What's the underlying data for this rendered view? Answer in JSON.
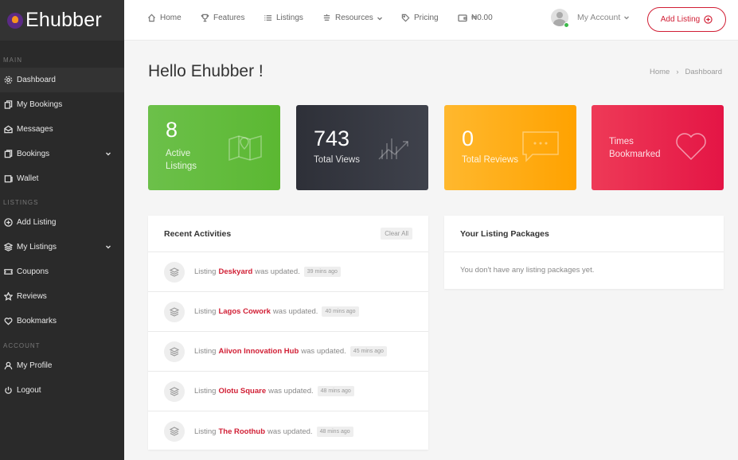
{
  "brand": {
    "name": "Ehubber"
  },
  "sidebar": {
    "sections": [
      {
        "label": "MAIN",
        "items": [
          {
            "label": "Dashboard",
            "icon": "gear-icon",
            "active": true
          },
          {
            "label": "My Bookings",
            "icon": "bookmark-copy-icon"
          },
          {
            "label": "Messages",
            "icon": "envelope-icon"
          },
          {
            "label": "Bookings",
            "icon": "calendar-icon",
            "expandable": true
          },
          {
            "label": "Wallet",
            "icon": "wallet-icon"
          }
        ]
      },
      {
        "label": "LISTINGS",
        "items": [
          {
            "label": "Add Listing",
            "icon": "plus-circle-icon"
          },
          {
            "label": "My Listings",
            "icon": "layers-icon",
            "expandable": true
          },
          {
            "label": "Coupons",
            "icon": "ticket-icon"
          },
          {
            "label": "Reviews",
            "icon": "star-icon"
          },
          {
            "label": "Bookmarks",
            "icon": "heart-icon"
          }
        ]
      },
      {
        "label": "ACCOUNT",
        "items": [
          {
            "label": "My Profile",
            "icon": "user-icon"
          },
          {
            "label": "Logout",
            "icon": "power-icon"
          }
        ]
      }
    ]
  },
  "header": {
    "nav": [
      {
        "label": "Home",
        "icon": "home-icon"
      },
      {
        "label": "Features",
        "icon": "trophy-icon"
      },
      {
        "label": "Listings",
        "icon": "list-icon"
      },
      {
        "label": "Resources",
        "icon": "stack-icon",
        "dropdown": true
      },
      {
        "label": "Pricing",
        "icon": "tag-icon"
      },
      {
        "label": "₦0.00",
        "icon": "wallet-icon"
      }
    ],
    "account_label": "My Account",
    "add_listing_label": "Add Listing"
  },
  "page": {
    "greeting": "Hello Ehubber !",
    "breadcrumb": [
      "Home",
      "Dashboard"
    ]
  },
  "stats": [
    {
      "value": "8",
      "label_line1": "Active",
      "label_line2": "Listings",
      "color_from": "#6cc04a",
      "color_to": "#5bb832",
      "icon": "map-icon"
    },
    {
      "value": "743",
      "label_line1": "Total Views",
      "label_line2": "",
      "color_from": "#2e3038",
      "color_to": "#3f424c",
      "icon": "chart-icon"
    },
    {
      "value": "0",
      "label_line1": "Total Reviews",
      "label_line2": "",
      "color_from": "#ffb82e",
      "color_to": "#ffa200",
      "icon": "chat-icon"
    },
    {
      "value": "",
      "label_line1": "Times",
      "label_line2": "Bookmarked",
      "color_from": "#ee3a57",
      "color_to": "#e41545",
      "icon": "heart-icon"
    }
  ],
  "activities": {
    "title": "Recent Activities",
    "clear_label": "Clear All",
    "prefix": "Listing",
    "suffix": "was updated.",
    "items": [
      {
        "name": "Deskyard",
        "time": "39 mins ago"
      },
      {
        "name": "Lagos Cowork",
        "time": "40 mins ago"
      },
      {
        "name": "Aiivon Innovation Hub",
        "time": "45 mins ago"
      },
      {
        "name": "Olotu Square",
        "time": "48 mins ago"
      },
      {
        "name": "The Roothub",
        "time": "48 mins ago"
      }
    ]
  },
  "packages": {
    "title": "Your Listing Packages",
    "empty_text": "You don't have any listing packages yet."
  }
}
